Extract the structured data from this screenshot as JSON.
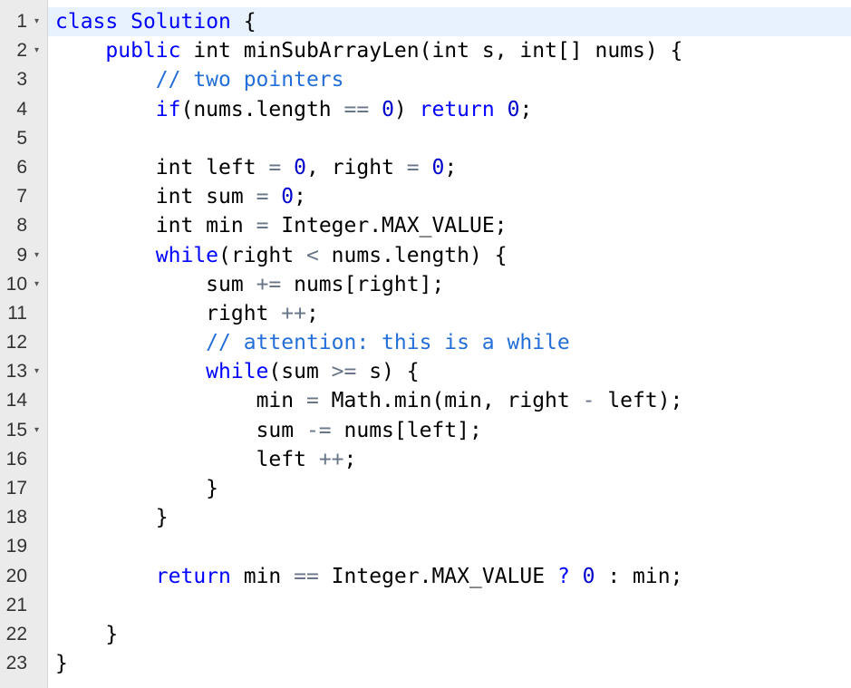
{
  "editor": {
    "lines": [
      {
        "n": "1",
        "fold": true,
        "active": true,
        "indent": "",
        "tokens": [
          {
            "t": "kw",
            "v": "class"
          },
          {
            "t": "sp",
            "v": " "
          },
          {
            "t": "kw",
            "v": "Solution"
          },
          {
            "t": "sp",
            "v": " "
          },
          {
            "t": "id",
            "v": "{"
          }
        ]
      },
      {
        "n": "2",
        "fold": true,
        "indent": "    ",
        "tokens": [
          {
            "t": "kw",
            "v": "public"
          },
          {
            "t": "sp",
            "v": " "
          },
          {
            "t": "typ",
            "v": "int"
          },
          {
            "t": "sp",
            "v": " "
          },
          {
            "t": "id",
            "v": "minSubArrayLen(int s, int[] nums) {"
          }
        ]
      },
      {
        "n": "3",
        "indent": "        ",
        "tokens": [
          {
            "t": "cmt",
            "v": "// two pointers"
          }
        ]
      },
      {
        "n": "4",
        "indent": "        ",
        "tokens": [
          {
            "t": "kw",
            "v": "if"
          },
          {
            "t": "id",
            "v": "(nums.length "
          },
          {
            "t": "op",
            "v": "=="
          },
          {
            "t": "id",
            "v": " "
          },
          {
            "t": "num",
            "v": "0"
          },
          {
            "t": "id",
            "v": ") "
          },
          {
            "t": "kw",
            "v": "return"
          },
          {
            "t": "id",
            "v": " "
          },
          {
            "t": "num",
            "v": "0"
          },
          {
            "t": "id",
            "v": ";"
          }
        ]
      },
      {
        "n": "5",
        "indent": "",
        "tokens": []
      },
      {
        "n": "6",
        "indent": "        ",
        "tokens": [
          {
            "t": "typ",
            "v": "int"
          },
          {
            "t": "id",
            "v": " left "
          },
          {
            "t": "op",
            "v": "="
          },
          {
            "t": "id",
            "v": " "
          },
          {
            "t": "num",
            "v": "0"
          },
          {
            "t": "id",
            "v": ", right "
          },
          {
            "t": "op",
            "v": "="
          },
          {
            "t": "id",
            "v": " "
          },
          {
            "t": "num",
            "v": "0"
          },
          {
            "t": "id",
            "v": ";"
          }
        ]
      },
      {
        "n": "7",
        "indent": "        ",
        "tokens": [
          {
            "t": "typ",
            "v": "int"
          },
          {
            "t": "id",
            "v": " sum "
          },
          {
            "t": "op",
            "v": "="
          },
          {
            "t": "id",
            "v": " "
          },
          {
            "t": "num",
            "v": "0"
          },
          {
            "t": "id",
            "v": ";"
          }
        ]
      },
      {
        "n": "8",
        "indent": "        ",
        "tokens": [
          {
            "t": "typ",
            "v": "int"
          },
          {
            "t": "id",
            "v": " min "
          },
          {
            "t": "op",
            "v": "="
          },
          {
            "t": "id",
            "v": " Integer.MAX_VALUE;"
          }
        ]
      },
      {
        "n": "9",
        "fold": true,
        "indent": "        ",
        "tokens": [
          {
            "t": "kw",
            "v": "while"
          },
          {
            "t": "id",
            "v": "(right "
          },
          {
            "t": "op",
            "v": "<"
          },
          {
            "t": "id",
            "v": " nums.length) {"
          }
        ]
      },
      {
        "n": "10",
        "fold": true,
        "indent": "            ",
        "tokens": [
          {
            "t": "id",
            "v": "sum "
          },
          {
            "t": "op",
            "v": "+="
          },
          {
            "t": "id",
            "v": " nums[right];"
          }
        ]
      },
      {
        "n": "11",
        "indent": "            ",
        "tokens": [
          {
            "t": "id",
            "v": "right "
          },
          {
            "t": "op",
            "v": "++"
          },
          {
            "t": "id",
            "v": ";"
          }
        ]
      },
      {
        "n": "12",
        "indent": "            ",
        "tokens": [
          {
            "t": "cmt",
            "v": "// attention: this is a while"
          }
        ]
      },
      {
        "n": "13",
        "fold": true,
        "indent": "            ",
        "tokens": [
          {
            "t": "kw",
            "v": "while"
          },
          {
            "t": "id",
            "v": "(sum "
          },
          {
            "t": "op",
            "v": ">="
          },
          {
            "t": "id",
            "v": " s) {"
          }
        ]
      },
      {
        "n": "14",
        "indent": "                ",
        "tokens": [
          {
            "t": "id",
            "v": "min "
          },
          {
            "t": "op",
            "v": "="
          },
          {
            "t": "id",
            "v": " Math.min(min, right "
          },
          {
            "t": "op",
            "v": "-"
          },
          {
            "t": "id",
            "v": " left);"
          }
        ]
      },
      {
        "n": "15",
        "fold": true,
        "indent": "                ",
        "tokens": [
          {
            "t": "id",
            "v": "sum "
          },
          {
            "t": "op",
            "v": "-="
          },
          {
            "t": "id",
            "v": " nums[left];"
          }
        ]
      },
      {
        "n": "16",
        "indent": "                ",
        "tokens": [
          {
            "t": "id",
            "v": "left "
          },
          {
            "t": "op",
            "v": "++"
          },
          {
            "t": "id",
            "v": ";"
          }
        ]
      },
      {
        "n": "17",
        "indent": "            ",
        "tokens": [
          {
            "t": "id",
            "v": "}"
          }
        ]
      },
      {
        "n": "18",
        "indent": "        ",
        "tokens": [
          {
            "t": "id",
            "v": "}"
          }
        ]
      },
      {
        "n": "19",
        "indent": "",
        "tokens": []
      },
      {
        "n": "20",
        "indent": "        ",
        "tokens": [
          {
            "t": "kw",
            "v": "return"
          },
          {
            "t": "id",
            "v": " min "
          },
          {
            "t": "op",
            "v": "=="
          },
          {
            "t": "id",
            "v": " Integer.MAX_VALUE "
          },
          {
            "t": "kw",
            "v": "?"
          },
          {
            "t": "id",
            "v": " "
          },
          {
            "t": "num",
            "v": "0"
          },
          {
            "t": "id",
            "v": " : min;"
          }
        ]
      },
      {
        "n": "21",
        "indent": "",
        "tokens": []
      },
      {
        "n": "22",
        "indent": "    ",
        "tokens": [
          {
            "t": "id",
            "v": "}"
          }
        ]
      },
      {
        "n": "23",
        "indent": "",
        "tokens": [
          {
            "t": "id",
            "v": "}"
          }
        ]
      }
    ],
    "fold_glyph": "▾"
  }
}
